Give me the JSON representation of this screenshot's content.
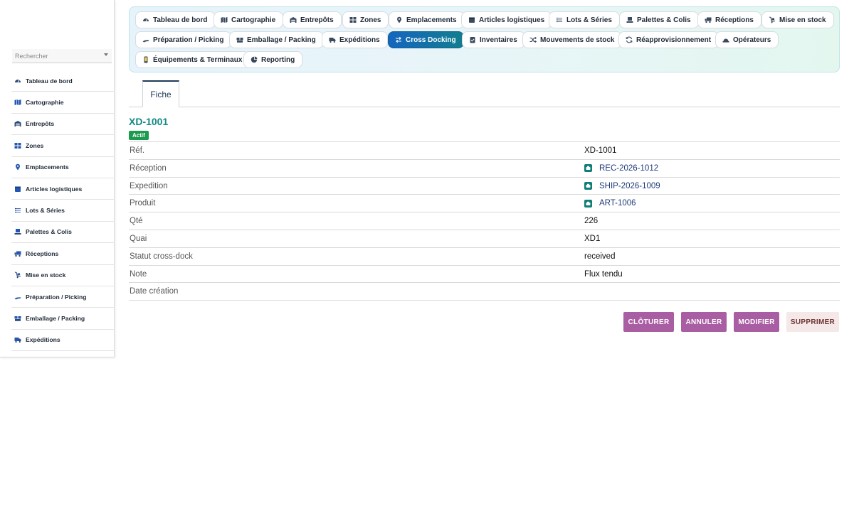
{
  "sidebar": {
    "search_placeholder": "Rechercher",
    "items": [
      {
        "label": "Tableau de bord",
        "icon": "gauge-icon"
      },
      {
        "label": "Cartographie",
        "icon": "map-icon"
      },
      {
        "label": "Entrepôts",
        "icon": "warehouse-icon"
      },
      {
        "label": "Zones",
        "icon": "grid-icon"
      },
      {
        "label": "Emplacements",
        "icon": "map-pin-icon"
      },
      {
        "label": "Articles logistiques",
        "icon": "box-icon"
      },
      {
        "label": "Lots & Séries",
        "icon": "list-icon"
      },
      {
        "label": "Palettes & Colis",
        "icon": "pallet-icon"
      },
      {
        "label": "Réceptions",
        "icon": "truck-loading-icon"
      },
      {
        "label": "Mise en stock",
        "icon": "dolly-icon"
      },
      {
        "label": "Préparation / Picking",
        "icon": "hand-icon"
      },
      {
        "label": "Emballage / Packing",
        "icon": "boxes-icon"
      },
      {
        "label": "Expéditions",
        "icon": "truck-icon"
      }
    ]
  },
  "topnav": {
    "items": [
      {
        "label": "Tableau de bord",
        "icon": "gauge-icon"
      },
      {
        "label": "Cartographie",
        "icon": "map-icon"
      },
      {
        "label": "Entrepôts",
        "icon": "warehouse-icon"
      },
      {
        "label": "Zones",
        "icon": "grid-icon"
      },
      {
        "label": "Emplacements",
        "icon": "map-pin-icon"
      },
      {
        "label": "Articles logistiques",
        "icon": "box-icon"
      },
      {
        "label": "Lots & Séries",
        "icon": "list-icon"
      },
      {
        "label": "Palettes & Colis",
        "icon": "pallet-icon"
      },
      {
        "label": "Réceptions",
        "icon": "truck-loading-icon"
      },
      {
        "label": "Mise en stock",
        "icon": "dolly-icon"
      },
      {
        "label": "Préparation / Picking",
        "icon": "hand-icon"
      },
      {
        "label": "Emballage / Packing",
        "icon": "boxes-icon"
      },
      {
        "label": "Expéditions",
        "icon": "truck-icon"
      },
      {
        "label": "Cross Docking",
        "icon": "exchange-icon",
        "active": true
      },
      {
        "label": "Inventaires",
        "icon": "clipboard-check-icon"
      },
      {
        "label": "Mouvements de stock",
        "icon": "shuffle-icon"
      },
      {
        "label": "Réapprovisionnement",
        "icon": "sync-icon"
      },
      {
        "label": "Opérateurs",
        "icon": "hard-hat-icon"
      },
      {
        "label": "Équipements & Terminaux",
        "icon": "mobile-icon"
      },
      {
        "label": "Reporting",
        "icon": "pie-chart-icon"
      }
    ]
  },
  "tabs": {
    "fiche": "Fiche"
  },
  "record": {
    "title": "XD-1001",
    "status_badge": "Actif",
    "fields": [
      {
        "label": "Réf.",
        "value": "XD-1001"
      },
      {
        "label": "Réception",
        "value": "REC-2026-1012",
        "link": true
      },
      {
        "label": "Expedition",
        "value": "SHIP-2026-1009",
        "link": true
      },
      {
        "label": "Produit",
        "value": "ART-1006",
        "link": true
      },
      {
        "label": "Qté",
        "value": "226"
      },
      {
        "label": "Quai",
        "value": "XD1"
      },
      {
        "label": "Statut cross-dock",
        "value": "received"
      },
      {
        "label": "Note",
        "value": "Flux tendu"
      },
      {
        "label": "Date création",
        "value": ""
      }
    ]
  },
  "actions": {
    "close": "CLÔTURER",
    "cancel": "ANNULER",
    "edit": "MODIFIER",
    "delete": "SUPPRIMER"
  },
  "colors": {
    "accent_teal": "#128a86",
    "active_chip": "#1565c0",
    "badge_green": "#1c9a4f",
    "action_purple": "#a95da2",
    "delete_bg": "#f4e8e8"
  }
}
